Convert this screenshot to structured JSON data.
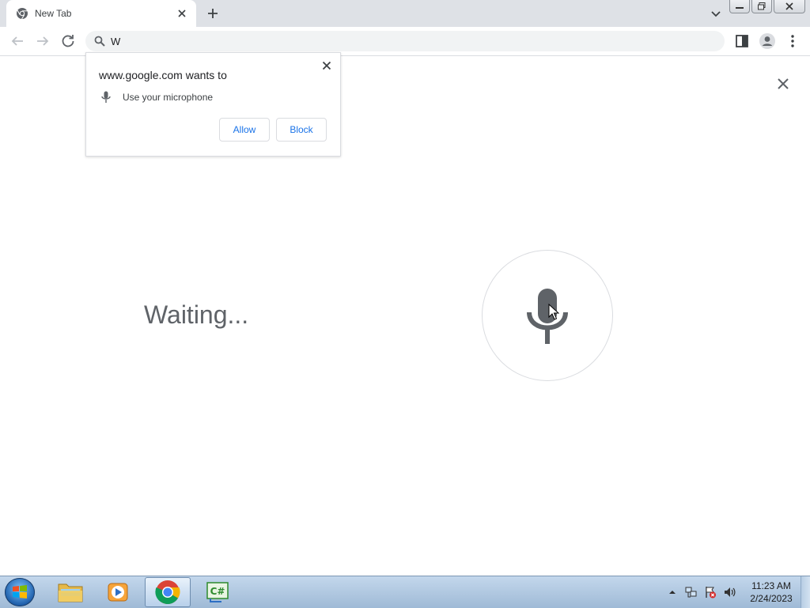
{
  "browser": {
    "tab_title": "New Tab",
    "omnibox_value": "W"
  },
  "permission_prompt": {
    "origin_text": "www.google.com wants to",
    "permission_text": "Use your microphone",
    "allow_label": "Allow",
    "block_label": "Block"
  },
  "voice_search": {
    "status_text": "Waiting..."
  },
  "taskbar": {
    "apps": [
      "windows-explorer",
      "media-player",
      "chrome",
      "csharp-ide"
    ],
    "clock_time": "11:23 AM",
    "clock_date": "2/24/2023"
  },
  "colors": {
    "accent": "#1a73e8",
    "mic": "#5f6368",
    "tabstrip": "#dee1e6"
  }
}
